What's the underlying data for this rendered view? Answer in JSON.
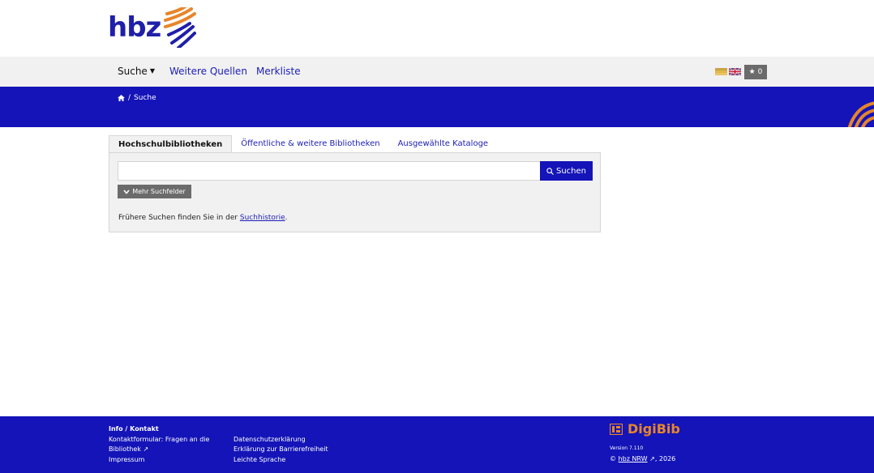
{
  "logo": {
    "text": "hbz"
  },
  "nav": {
    "search": "Suche",
    "more_sources": "Weitere Quellen",
    "watchlist": "Merkliste",
    "star_count": "0"
  },
  "breadcrumb": {
    "current": "Suche"
  },
  "tabs": [
    {
      "label": "Hochschulbibliotheken"
    },
    {
      "label": "Öffentliche & weitere Bibliotheken"
    },
    {
      "label": "Ausgewählte Kataloge"
    }
  ],
  "search": {
    "value": "",
    "button_label": "Suchen",
    "more_fields_label": "Mehr Suchfelder",
    "history_prefix": "Frühere Suchen finden Sie in der ",
    "history_link": "Suchhistorie",
    "history_suffix": "."
  },
  "footer": {
    "title": "Info / Kontakt",
    "col1": [
      "Kontaktformular: Fragen an die",
      "Bibliothek",
      "Impressum"
    ],
    "col2": [
      "Datenschutzerklärung",
      "Erklärung zur Barrierefreiheit",
      "Leichte Sprache"
    ],
    "brand": "DigiBib",
    "version": "Version 7.110",
    "copyright_prefix": "© ",
    "copyright_link": "hbz NRW",
    "copyright_suffix": ", 2026"
  },
  "colors": {
    "brand_blue": "#1414b8",
    "accent_orange": "#e7852a",
    "nav_bg": "#f1f1f1"
  }
}
